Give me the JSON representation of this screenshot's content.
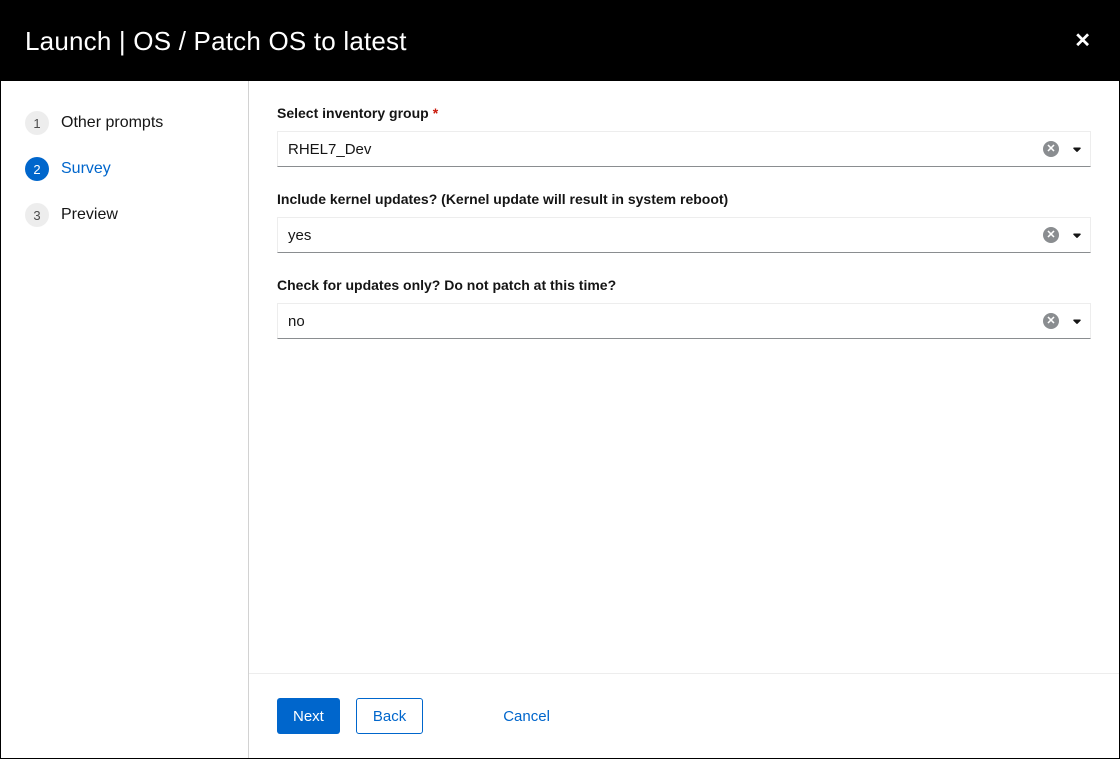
{
  "header": {
    "title": "Launch | OS / Patch OS to latest"
  },
  "sidebar": {
    "steps": [
      {
        "num": "1",
        "label": "Other prompts",
        "active": false
      },
      {
        "num": "2",
        "label": "Survey",
        "active": true
      },
      {
        "num": "3",
        "label": "Preview",
        "active": false
      }
    ]
  },
  "form": {
    "fields": [
      {
        "label": "Select inventory group",
        "required": true,
        "value": "RHEL7_Dev"
      },
      {
        "label": "Include kernel updates? (Kernel update will result in system reboot)",
        "required": false,
        "value": "yes"
      },
      {
        "label": "Check for updates only? Do not patch at this time?",
        "required": false,
        "value": "no"
      }
    ]
  },
  "footer": {
    "next": "Next",
    "back": "Back",
    "cancel": "Cancel"
  }
}
